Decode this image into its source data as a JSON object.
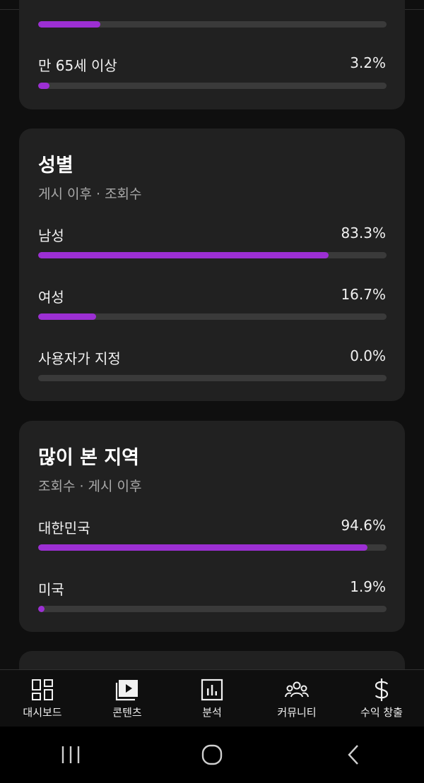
{
  "age_card": {
    "rows": [
      {
        "label": "",
        "value": "",
        "percent": 17.8
      },
      {
        "label": "만 65세 이상",
        "value": "3.2%",
        "percent": 3.2
      }
    ]
  },
  "gender_card": {
    "title": "성별",
    "subtitle": "게시 이후 · 조회수",
    "rows": [
      {
        "label": "남성",
        "value": "83.3%",
        "percent": 83.3
      },
      {
        "label": "여성",
        "value": "16.7%",
        "percent": 16.7
      },
      {
        "label": "사용자가 지정",
        "value": "0.0%",
        "percent": 0.0
      }
    ]
  },
  "region_card": {
    "title": "많이 본 지역",
    "subtitle": "조회수 · 게시 이후",
    "rows": [
      {
        "label": "대한민국",
        "value": "94.6%",
        "percent": 94.6
      },
      {
        "label": "미국",
        "value": "1.9%",
        "percent": 1.9
      }
    ]
  },
  "bottom_nav": {
    "items": [
      {
        "label": "대시보드",
        "icon": "dashboard-icon"
      },
      {
        "label": "콘텐츠",
        "icon": "content-icon"
      },
      {
        "label": "분석",
        "icon": "analytics-icon"
      },
      {
        "label": "커뮤니티",
        "icon": "community-icon"
      },
      {
        "label": "수익 창출",
        "icon": "dollar-icon"
      }
    ]
  },
  "system_bar": {
    "buttons": [
      "recent-apps-icon",
      "home-icon",
      "back-icon"
    ]
  },
  "colors": {
    "accent": "#9c2fd3",
    "track": "#3a3a3a",
    "card": "#212121",
    "background": "#0f0f0f"
  }
}
